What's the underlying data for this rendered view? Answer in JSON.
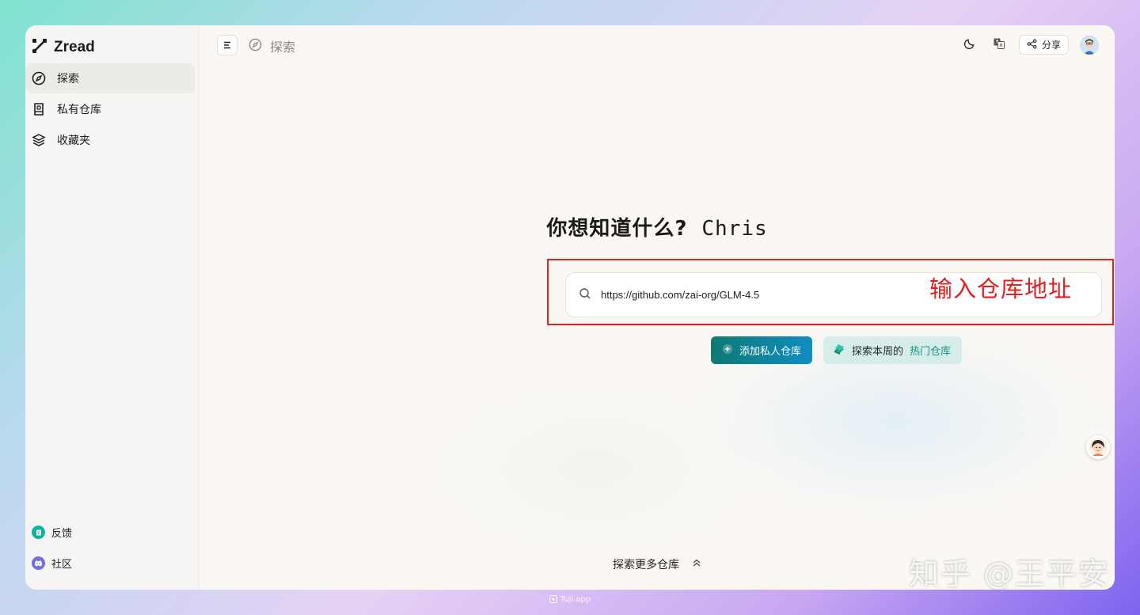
{
  "brand": {
    "name": "Zread"
  },
  "sidebar": {
    "items": [
      {
        "label": "探索",
        "icon": "compass-icon",
        "active": true
      },
      {
        "label": "私有仓库",
        "icon": "private-repo-icon",
        "active": false
      },
      {
        "label": "收藏夹",
        "icon": "layers-icon",
        "active": false
      }
    ],
    "bottom": [
      {
        "label": "反馈",
        "icon": "feedback-icon",
        "color": "#10b3a3"
      },
      {
        "label": "社区",
        "icon": "discord-icon",
        "color": "#6d6ee8"
      }
    ]
  },
  "header": {
    "breadcrumb": "探索",
    "share_label": "分享"
  },
  "hero": {
    "question": "你想知道什么?",
    "user_name": "Chris"
  },
  "search": {
    "value": "https://github.com/zai-org/GLM-4.5",
    "annotation": "输入仓库地址"
  },
  "actions": {
    "add_private": "添加私人仓库",
    "explore_prefix": "探索本周的",
    "explore_accent": "热门仓库"
  },
  "footer": {
    "explore_more": "探索更多仓库"
  },
  "overlay": {
    "watermark": "知乎 @王平安",
    "source_tag": "Tuji.app"
  },
  "colors": {
    "primary_start": "#0d7a73",
    "primary_end": "#118dc1",
    "annotation": "#e02020",
    "accent_text": "#0d9488"
  }
}
